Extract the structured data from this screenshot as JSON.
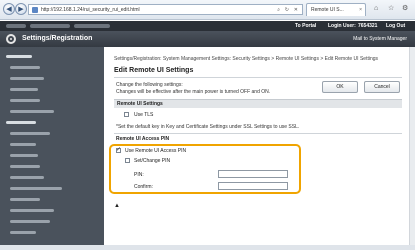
{
  "browser": {
    "back_glyph": "◀",
    "forward_glyph": "▶",
    "url": "http://192.168.1.24/rui_security_rui_edit.html",
    "url_search_glyph": "⌕",
    "url_refresh_glyph": "↻",
    "url_close_glyph": "✕",
    "tab_label": "Remote UI S...",
    "tab_close_glyph": "×",
    "home_glyph": "⌂",
    "star_glyph": "☆",
    "settings_glyph": "⚙"
  },
  "header": {
    "to_portal": "To Portal",
    "login_user": "Login User:",
    "login_user_value": "7654321",
    "log_out": "Log Out",
    "app_title": "Settings/Registration",
    "mail_admin": "Mail to System Manager"
  },
  "main": {
    "breadcrumb": "Settings/Registration: System Management Settings: Security Settings > Remote UI Settings > Edit Remote UI Settings",
    "page_title": "Edit Remote UI Settings",
    "change_note_1": "Change the following settings:",
    "change_note_2": "Changes will be effective after the main power is turned OFF and ON.",
    "ok_label": "OK",
    "cancel_label": "Cancel",
    "remote_ui_section": "Remote UI Settings",
    "use_tls_label": "Use TLS",
    "use_tls_checked": false,
    "tls_note": "*Set the default key in Key and Certificate Settings under SSL Settings to use SSL.",
    "access_pin_heading": "Remote UI Access PIN",
    "use_pin_label": "Use Remote UI Access PIN",
    "use_pin_checked": true,
    "set_pin_label": "Set/Change PIN",
    "set_pin_checked": false,
    "pin_label": "PIN:",
    "pin_value": "",
    "confirm_label": "Confirm:",
    "confirm_value": "",
    "to_top_glyph": "▲"
  },
  "colors": {
    "highlight": "#f0a400",
    "sidebar_bg": "#4a525c",
    "title_bar": "#343a42"
  }
}
